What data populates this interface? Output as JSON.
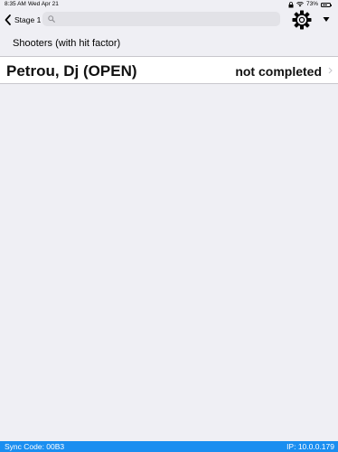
{
  "status_bar": {
    "time": "8:35 AM",
    "date": "Wed Apr 21",
    "battery": "73%",
    "battery_level": 0.73
  },
  "nav": {
    "back_label": "Stage 1",
    "search_value": "",
    "search_placeholder": ""
  },
  "section": {
    "title": "Shooters (with hit factor)"
  },
  "rows": [
    {
      "name": "Petrou, Dj (OPEN)",
      "status": "not completed"
    }
  ],
  "footer": {
    "sync_code": "Sync Code: 00B3",
    "ip": "IP: 10.0.0.179"
  },
  "colors": {
    "footer_bg": "#1a8ef0",
    "annotation_arrow": "#e8141c",
    "background": "#efeff4"
  }
}
